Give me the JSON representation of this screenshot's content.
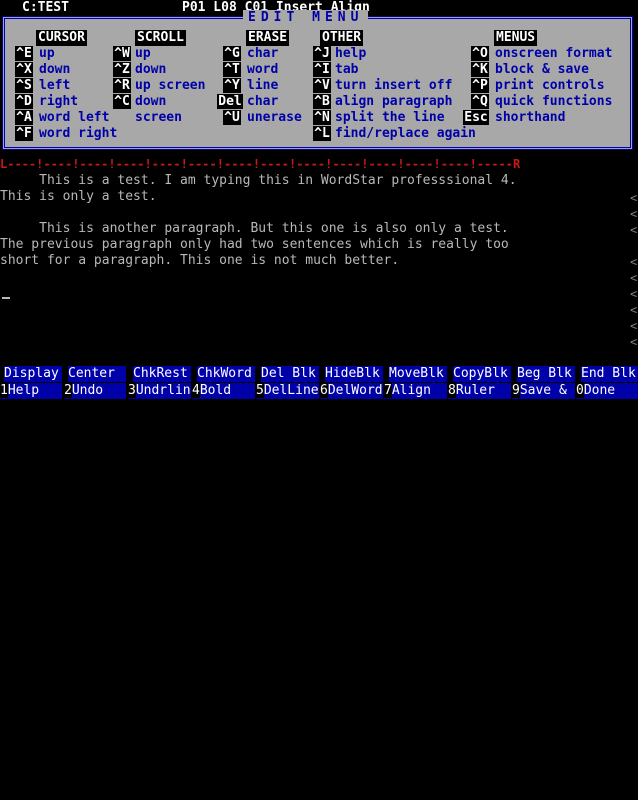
{
  "status": {
    "filename": "C:TEST",
    "position": "P01 L08 C01 Insert Align"
  },
  "menu": {
    "title": "EDIT MENU",
    "columns": {
      "cursor": {
        "heading": "CURSOR",
        "items": [
          {
            "key": "^E",
            "label": "up"
          },
          {
            "key": "^X",
            "label": "down"
          },
          {
            "key": "^S",
            "label": "left"
          },
          {
            "key": "^D",
            "label": "right"
          },
          {
            "key": "^A",
            "label": "word left"
          },
          {
            "key": "^F",
            "label": "word right"
          }
        ]
      },
      "scroll": {
        "heading": "SCROLL",
        "items": [
          {
            "key": "^W",
            "label": "up"
          },
          {
            "key": "^Z",
            "label": "down"
          },
          {
            "key": "^R",
            "label": "up screen"
          },
          {
            "key": "^C",
            "label": "down"
          },
          {
            "key": "",
            "label": "screen"
          }
        ]
      },
      "erase": {
        "heading": "ERASE",
        "items": [
          {
            "key": "^G",
            "label": "char"
          },
          {
            "key": "^T",
            "label": "word"
          },
          {
            "key": "^Y",
            "label": "line"
          },
          {
            "key": "Del",
            "label": "char"
          },
          {
            "key": "^U",
            "label": "unerase"
          }
        ]
      },
      "other": {
        "heading": "OTHER",
        "items": [
          {
            "key": "^J",
            "label": "help"
          },
          {
            "key": "^I",
            "label": "tab"
          },
          {
            "key": "^V",
            "label": "turn insert off"
          },
          {
            "key": "^B",
            "label": "align paragraph"
          },
          {
            "key": "^N",
            "label": "split the line"
          },
          {
            "key": "^L",
            "label": "find/replace again"
          }
        ]
      },
      "menus": {
        "heading": "MENUS",
        "items": [
          {
            "key": "^O",
            "label": "onscreen format"
          },
          {
            "key": "^K",
            "label": "block & save"
          },
          {
            "key": "^P",
            "label": "print controls"
          },
          {
            "key": "^Q",
            "label": "quick functions"
          },
          {
            "key": "Esc",
            "label": "shorthand"
          }
        ]
      }
    }
  },
  "ruler": {
    "text": "L----!----!----!----!----!----!----!----!----!----!----!----!----!-----R"
  },
  "document": {
    "lines": [
      "     This is a test. I am typing this in WordStar professsional 4.",
      "This is only a test.",
      "",
      "     This is another paragraph. But this one is also only a test.",
      "The previous paragraph only had two sentences which is really too",
      "short for a paragraph. This one is not much better."
    ],
    "flag_char": "<"
  },
  "fkeys": {
    "shifted": [
      "Display",
      "Center",
      "ChkRest",
      "ChkWord",
      "Del Blk",
      "HideBlk",
      "MoveBlk",
      "CopyBlk",
      "Beg Blk",
      "End Blk"
    ],
    "numbers": [
      "1",
      "2",
      "3",
      "4",
      "5",
      "6",
      "7",
      "8",
      "9",
      "0"
    ],
    "plain": [
      "Help",
      "Undo",
      "Undrlin",
      "Bold",
      "DelLine",
      "DelWord",
      "Align",
      "Ruler",
      "Save &",
      "Done"
    ]
  }
}
